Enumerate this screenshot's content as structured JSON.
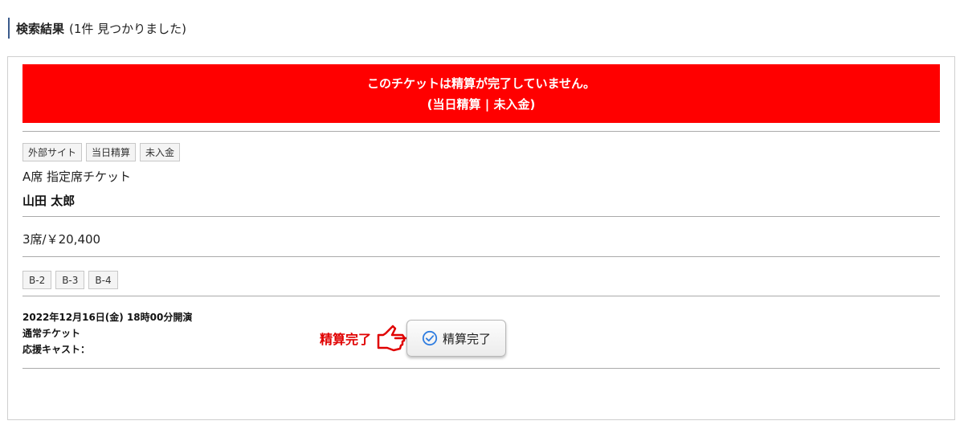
{
  "header": {
    "title": "検索結果",
    "count": "(1件 見つかりました)"
  },
  "alert": {
    "line1": "このチケットは精算が完了していません。",
    "line2": "(当日精算 | 未入金)",
    "color": "#ff0000"
  },
  "tags": [
    {
      "label": "外部サイト"
    },
    {
      "label": "当日精算"
    },
    {
      "label": "未入金"
    }
  ],
  "ticket": {
    "name": "A席 指定席チケット",
    "holder": "山田 太郎",
    "summary": "3席/￥20,400"
  },
  "seats": [
    {
      "label": "B-2"
    },
    {
      "label": "B-3"
    },
    {
      "label": "B-4"
    }
  ],
  "info": {
    "datetime": "2022年12月16日(金) 18時00分開演",
    "ticket_type": "通常チケット",
    "cast": "応援キャスト："
  },
  "action": {
    "hint": "精算完了",
    "button_label": "精算完了",
    "hint_color": "#e00000",
    "check_icon": "check-circle-icon",
    "pointer_icon": "pointing-hand-icon"
  }
}
